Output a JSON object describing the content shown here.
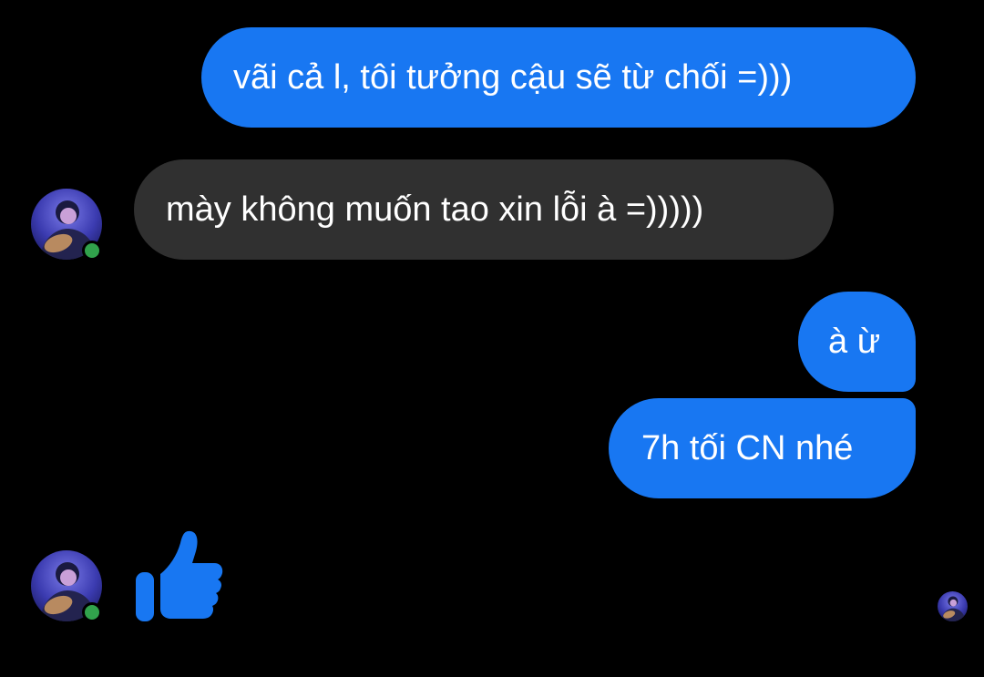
{
  "conversation": {
    "messages": [
      {
        "sender": "me",
        "text": "vãi cả l, tôi tưởng cậu sẽ từ chối =)))"
      },
      {
        "sender": "contact",
        "text": "mày không muốn tao xin lỗi à =)))))"
      },
      {
        "sender": "me",
        "text": "à ừ"
      },
      {
        "sender": "me",
        "text": "7h tối CN nhé"
      },
      {
        "sender": "contact",
        "text": "",
        "sticker": "thumbs-up-icon"
      }
    ]
  },
  "colors": {
    "outgoing_bubble": "#1877f2",
    "incoming_bubble": "#303030",
    "background": "#000000",
    "presence": "#31a24c",
    "like": "#1877f2"
  },
  "icons": {
    "contact_avatar": "contact-avatar",
    "seen_indicator": "seen-avatar-icon",
    "like_sticker": "thumbs-up-icon"
  }
}
